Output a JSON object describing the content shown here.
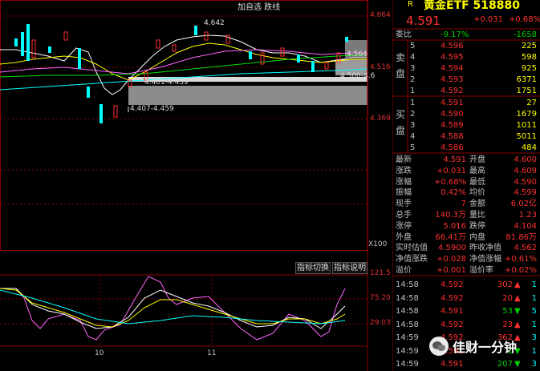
{
  "header": {
    "name": "黄金ETF 518880",
    "price": "4.591",
    "change": "+0.031",
    "change_pct": "+0.68%",
    "left_tabs": "加自选 跌线",
    "r_marker": "R"
  },
  "main_chart": {
    "y_top": "4.664",
    "y_mid": "4.516",
    "y_low": "4.369",
    "hi_label": "4.642",
    "band_label_1": "4.401-4.459",
    "band_label_2": "4.407-4.459",
    "band_label_3": "4.564",
    "band_label_4": "4.500-4.6",
    "scale_label": "X100"
  },
  "buttons": {
    "indicator_switch": "指标切换",
    "indicator_help": "指标说明"
  },
  "sub_chart": {
    "y_top": "121.5",
    "y_mid": "75.20",
    "y_low": "29.03",
    "x_label_1": "10",
    "x_label_2": "11"
  },
  "order_book": {
    "weibi_label": "委比",
    "weibi_val": "-9.17%",
    "weibi_diff": "-1658",
    "sell_label": "卖盘",
    "buy_label": "买盘",
    "sells": [
      {
        "lvl": "5",
        "price": "4.596",
        "vol": "225"
      },
      {
        "lvl": "4",
        "price": "4.595",
        "vol": "598"
      },
      {
        "lvl": "3",
        "price": "4.594",
        "vol": "925"
      },
      {
        "lvl": "2",
        "price": "4.593",
        "vol": "6371"
      },
      {
        "lvl": "1",
        "price": "4.592",
        "vol": "1751"
      }
    ],
    "buys": [
      {
        "lvl": "1",
        "price": "4.591",
        "vol": "27"
      },
      {
        "lvl": "2",
        "price": "4.590",
        "vol": "1679"
      },
      {
        "lvl": "3",
        "price": "4.589",
        "vol": "1011"
      },
      {
        "lvl": "4",
        "price": "4.588",
        "vol": "5011"
      },
      {
        "lvl": "5",
        "price": "4.586",
        "vol": "484"
      }
    ]
  },
  "stats": [
    {
      "l1": "最新",
      "v1": "4.591",
      "l2": "开盘",
      "v2": "4.600"
    },
    {
      "l1": "涨跌",
      "v1": "+0.031",
      "l2": "最高",
      "v2": "4.609"
    },
    {
      "l1": "涨幅",
      "v1": "+0.68%",
      "l2": "最低",
      "v2": "4.590"
    },
    {
      "l1": "振幅",
      "v1": "0.42%",
      "l2": "均价",
      "v2": "4.599"
    },
    {
      "l1": "现手",
      "v1": "7",
      "l2": "金额",
      "v2": "6.02亿"
    },
    {
      "l1": "总手",
      "v1": "140.3万",
      "l2": "量比",
      "v2": "1.23"
    },
    {
      "l1": "涨停",
      "v1": "5.016",
      "l2": "跌停",
      "v2": "4.104"
    },
    {
      "l1": "外盘",
      "v1": "66.41万",
      "l2": "内盘",
      "v2": "81.86万"
    },
    {
      "l1": "实时估值",
      "v1": "4.5900",
      "l2": "昨收净值",
      "v2": "4.562"
    },
    {
      "l1": "净值涨跌",
      "v1": "+0.028",
      "l2": "净值涨幅",
      "v2": "+0.61%"
    },
    {
      "l1": "溢价",
      "v1": "+0.001",
      "l2": "溢价率",
      "v2": "+0.02%"
    }
  ],
  "trades": [
    {
      "time": "14:58",
      "price": "4.592",
      "vol": "302",
      "dir": "up",
      "n": "1"
    },
    {
      "time": "14:58",
      "price": "4.592",
      "vol": "20",
      "dir": "up",
      "n": "1"
    },
    {
      "time": "14:58",
      "price": "4.591",
      "vol": "53",
      "dir": "down",
      "n": "5"
    },
    {
      "time": "14:58",
      "price": "4.592",
      "vol": "23",
      "dir": "up",
      "n": "1"
    },
    {
      "time": "14:59",
      "price": "4.592",
      "vol": "362",
      "dir": "up",
      "n": "3"
    },
    {
      "time": "14:59",
      "price": "4.591",
      "vol": "1",
      "dir": "down",
      "n": "1"
    },
    {
      "time": "14:59",
      "price": "4.591",
      "vol": "207",
      "dir": "down",
      "n": "3"
    }
  ],
  "watermark": "佳财一分钟",
  "colors": {
    "up": "#ff3030",
    "down": "#00d000",
    "cyan": "#00ffff",
    "yellow": "#ffff00",
    "grid": "#8a0000"
  }
}
